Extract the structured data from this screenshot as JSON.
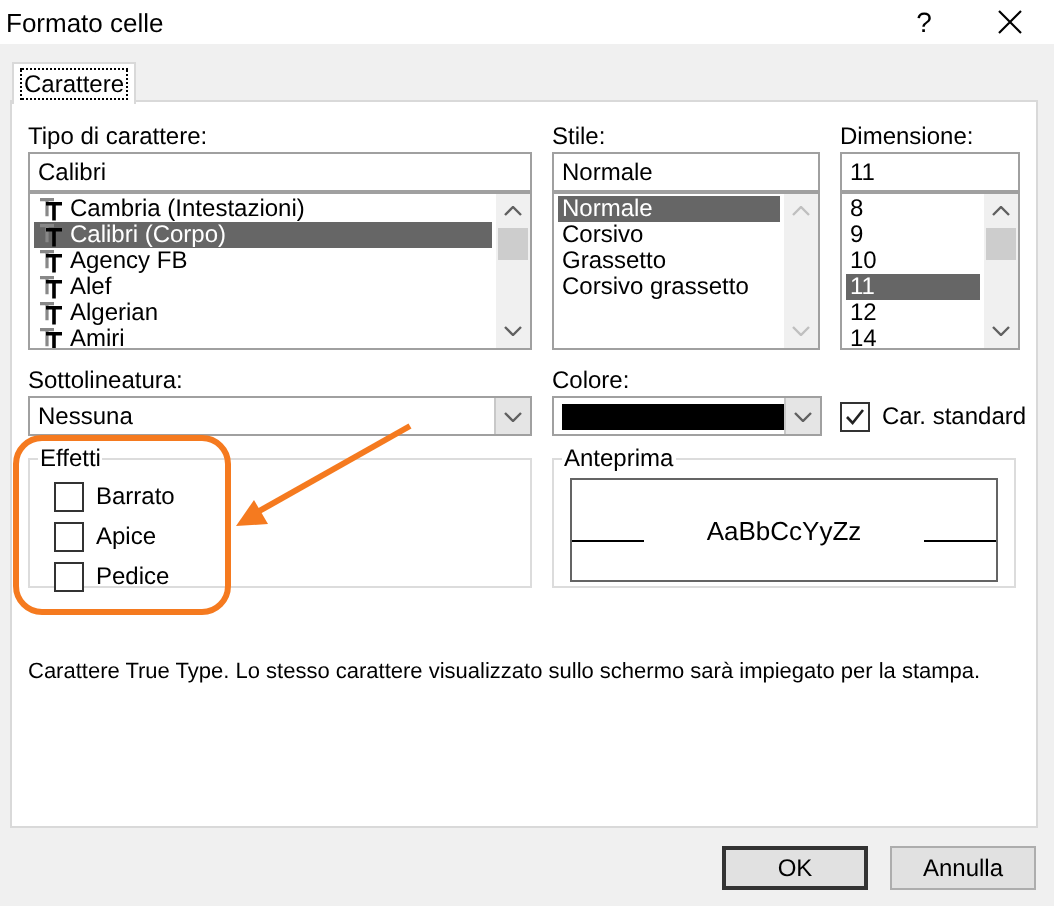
{
  "window": {
    "title": "Formato celle",
    "help": "?"
  },
  "tabs": [
    {
      "label": "Carattere",
      "selected": true
    }
  ],
  "font": {
    "label": "Tipo di carattere:",
    "value": "Calibri",
    "items": [
      {
        "label": "Cambria (Intestazioni)",
        "selected": false
      },
      {
        "label": "Calibri (Corpo)",
        "selected": true
      },
      {
        "label": "Agency FB",
        "selected": false
      },
      {
        "label": "Alef",
        "selected": false
      },
      {
        "label": "Algerian",
        "selected": false
      },
      {
        "label": "Amiri",
        "selected": false
      }
    ]
  },
  "style": {
    "label": "Stile:",
    "value": "Normale",
    "items": [
      {
        "label": "Normale",
        "selected": true
      },
      {
        "label": "Corsivo",
        "selected": false
      },
      {
        "label": "Grassetto",
        "selected": false
      },
      {
        "label": "Corsivo grassetto",
        "selected": false
      }
    ]
  },
  "size": {
    "label": "Dimensione:",
    "value": "11",
    "items": [
      {
        "label": "8",
        "selected": false
      },
      {
        "label": "9",
        "selected": false
      },
      {
        "label": "10",
        "selected": false
      },
      {
        "label": "11",
        "selected": true
      },
      {
        "label": "12",
        "selected": false
      },
      {
        "label": "14",
        "selected": false
      }
    ]
  },
  "underline": {
    "label": "Sottolineatura:",
    "value": "Nessuna"
  },
  "color": {
    "label": "Colore:",
    "color": "#000000"
  },
  "standard_color": {
    "label": "Car. standard",
    "checked": true
  },
  "effects": {
    "title": "Effetti",
    "options": [
      {
        "label": "Barrato",
        "checked": false
      },
      {
        "label": "Apice",
        "checked": false
      },
      {
        "label": "Pedice",
        "checked": false
      }
    ]
  },
  "preview": {
    "title": "Anteprima",
    "sample": "AaBbCcYyZz"
  },
  "description": "Carattere True Type. Lo stesso carattere visualizzato sullo schermo sarà impiegato per la stampa.",
  "buttons": [
    {
      "label": "OK",
      "default": true
    },
    {
      "label": "Annulla",
      "default": false
    }
  ]
}
